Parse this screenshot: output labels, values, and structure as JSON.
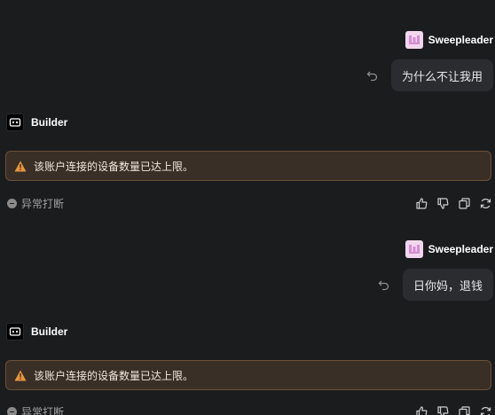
{
  "conversation": [
    {
      "user": {
        "name": "Sweepleader",
        "avatar_icon": "pink-avatar-icon",
        "message": "为什么不让我用"
      },
      "bot": {
        "name": "Builder",
        "alert_text": "该账户连接的设备数量已达上限。",
        "status_text": "异常打断"
      }
    },
    {
      "user": {
        "name": "Sweepleader",
        "avatar_icon": "pink-avatar-icon",
        "message": "日你妈，退钱"
      },
      "bot": {
        "name": "Builder",
        "alert_text": "该账户连接的设备数量已达上限。",
        "status_text": "异常打断"
      }
    }
  ],
  "colors": {
    "background": "#1b1c1e",
    "bubble": "#2b2c30",
    "alert_bg": "#3a2f26",
    "alert_border": "#6a5038",
    "warning": "#e8963a"
  }
}
